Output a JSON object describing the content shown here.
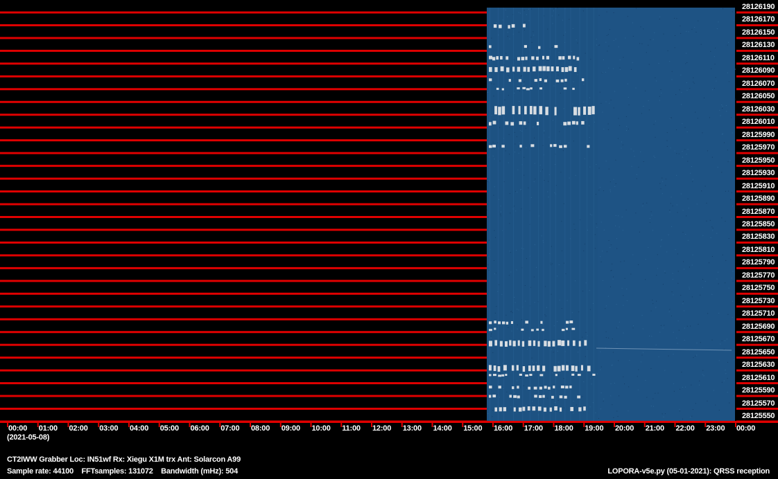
{
  "freq_labels": [
    "28126190",
    "28126170",
    "28126150",
    "28126130",
    "28126110",
    "28126090",
    "28126070",
    "28126050",
    "28126030",
    "28126010",
    "28125990",
    "28125970",
    "28125950",
    "28125930",
    "28125910",
    "28125890",
    "28125870",
    "28125850",
    "28125830",
    "28125810",
    "28125790",
    "28125770",
    "28125750",
    "28125730",
    "28125710",
    "28125690",
    "28125670",
    "28125650",
    "28125630",
    "28125610",
    "28125590",
    "28125570",
    "28125550"
  ],
  "hour_labels": [
    "00:00",
    "01:00",
    "02:00",
    "03:00",
    "04:00",
    "05:00",
    "06:00",
    "07:00",
    "08:00",
    "09:00",
    "10:00",
    "11:00",
    "12:00",
    "13:00",
    "14:00",
    "15:00",
    "16:00",
    "17:00",
    "18:00",
    "19:00",
    "20:00",
    "21:00",
    "22:00",
    "23:00",
    "00:00"
  ],
  "date": "(2021-05-08)",
  "station_info": "CT2IWW Grabber Loc: IN51wf Rx: Xiegu X1M trx Ant: Solarcon A99",
  "params": "Sample rate: 44100    FFTsamples: 131072    Bandwidth (mHz): 504",
  "program": "LOPORA-v5e.py (05-01-2021): QRSS reception",
  "colors": {
    "grid": "#e00000",
    "waterfall": "#1d5282",
    "signal": "#d8dde2"
  }
}
